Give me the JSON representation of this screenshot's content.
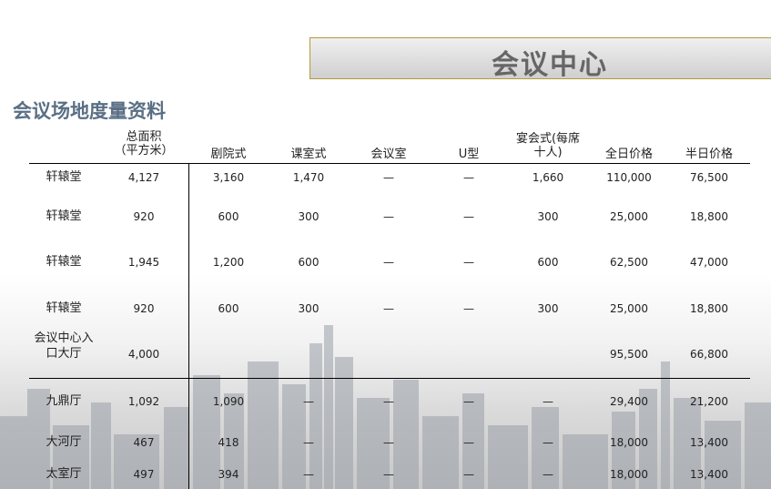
{
  "banner": {
    "title": "会议中心"
  },
  "subtitle": "会议场地度量资料",
  "headers": {
    "area_line1": "总面积",
    "area_line2": "（平方米）",
    "theater": "剧院式",
    "classroom": "课室式",
    "boardroom": "会议室",
    "ushape": "U型",
    "banquet_line1": "宴会式(每席",
    "banquet_line2": "十人)",
    "full_day": "全日价格",
    "half_day": "半日价格"
  },
  "rows": [
    {
      "name": [
        "轩辕堂"
      ],
      "area": "4,127",
      "theater": "3,160",
      "classroom": "1,470",
      "boardroom": "—",
      "ushape": "—",
      "banquet": "1,660",
      "full_day": "110,000",
      "half_day": "76,500"
    },
    {
      "name": [
        "轩辕堂"
      ],
      "area": "920",
      "theater": "600",
      "classroom": "300",
      "boardroom": "—",
      "ushape": "—",
      "banquet": "300",
      "full_day": "25,000",
      "half_day": "18,800"
    },
    {
      "name": [
        "轩辕堂"
      ],
      "area": "1,945",
      "theater": "1,200",
      "classroom": "600",
      "boardroom": "—",
      "ushape": "—",
      "banquet": "600",
      "full_day": "62,500",
      "half_day": "47,000"
    },
    {
      "name": [
        "轩辕堂"
      ],
      "area": "920",
      "theater": "600",
      "classroom": "300",
      "boardroom": "—",
      "ushape": "—",
      "banquet": "300",
      "full_day": "25,000",
      "half_day": "18,800"
    },
    {
      "name": [
        "会议中心入",
        "口大厅"
      ],
      "area": "4,000",
      "theater": "",
      "classroom": "",
      "boardroom": "",
      "ushape": "",
      "banquet": "",
      "full_day": "95,500",
      "half_day": "66,800"
    },
    {
      "name": [
        "九鼎厅"
      ],
      "area": "1,092",
      "theater": "1,090",
      "classroom": "—",
      "boardroom": "—",
      "ushape": "—",
      "banquet": "—",
      "full_day": "29,400",
      "half_day": "21,200"
    },
    {
      "name": [
        "大河厅"
      ],
      "area": "467",
      "theater": "418",
      "classroom": "—",
      "boardroom": "—",
      "ushape": "—",
      "banquet": "—",
      "full_day": "18,000",
      "half_day": "13,400"
    },
    {
      "name": [
        "太室厅"
      ],
      "area": "497",
      "theater": "394",
      "classroom": "—",
      "boardroom": "—",
      "ushape": "—",
      "banquet": "—",
      "full_day": "18,000",
      "half_day": "13,400"
    }
  ]
}
